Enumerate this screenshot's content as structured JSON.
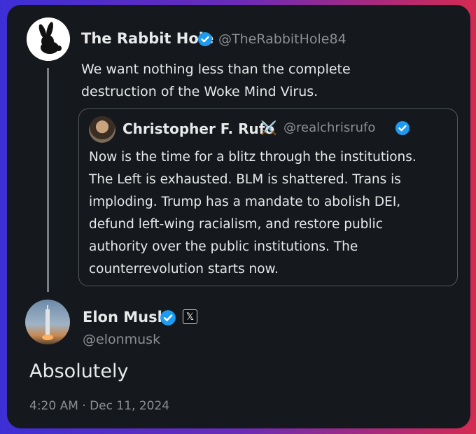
{
  "parent_tweet": {
    "author_name": "The Rabbit Hole",
    "handle": "@TheRabbitHole84",
    "text_line1": "We want nothing less than the complete",
    "text_line2": "destruction of the Woke Mind Virus.",
    "avatar_icon": "rabbit-icon"
  },
  "quoted_tweet": {
    "author_name": "Christopher F. Rufo",
    "author_emoji": "⚔️",
    "handle": "@realchrisrufo",
    "lines": [
      "Now is the time for a blitz through the institutions.",
      "The Left is exhausted. BLM is shattered. Trans is",
      "imploding. Trump has a mandate to abolish DEI,",
      "defund left-wing racialism, and restore public",
      "authority over the public institutions. The",
      "counterrevolution starts now."
    ]
  },
  "main_tweet": {
    "author_name": "Elon Musk",
    "handle": "@elonmusk",
    "text": "Absolutely",
    "timestamp": "4:20 AM · Dec 11, 2024",
    "affiliation_badge": "𝕏"
  },
  "colors": {
    "verified": "#1d9bf0",
    "background": "#15181c",
    "text": "#e7e9ea",
    "muted": "#8b9095"
  }
}
